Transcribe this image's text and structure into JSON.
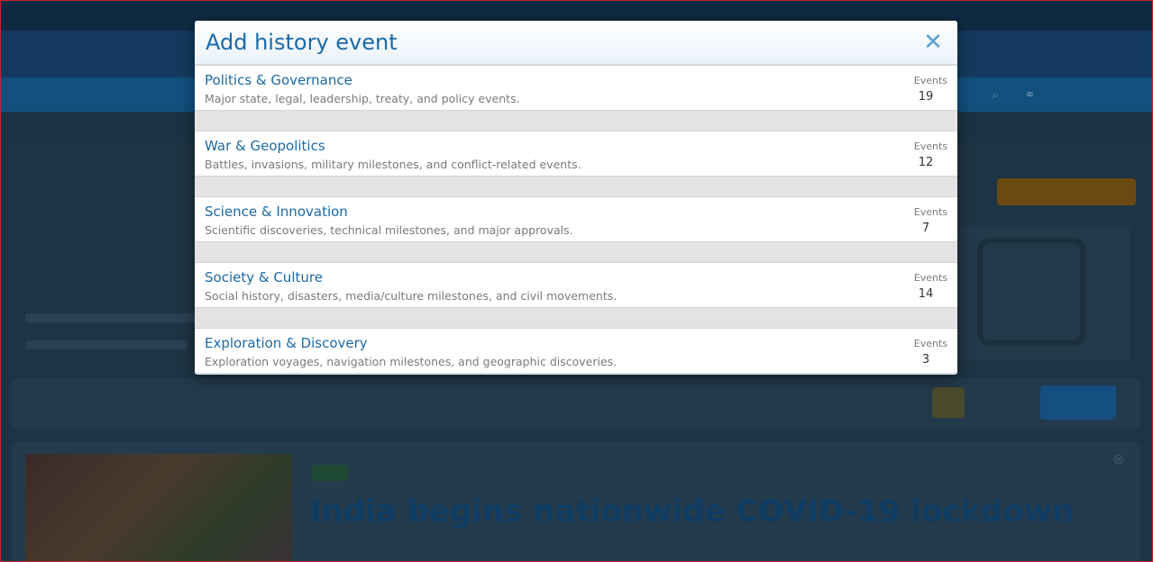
{
  "modal": {
    "title": "Add history event",
    "close_icon": "close-icon",
    "categories": [
      {
        "name": "Politics & Governance",
        "description": "Major state, legal, leadership, treaty, and policy events.",
        "count_label": "Events",
        "count": "19"
      },
      {
        "name": "War & Geopolitics",
        "description": "Battles, invasions, military milestones, and conflict-related events.",
        "count_label": "Events",
        "count": "12"
      },
      {
        "name": "Science & Innovation",
        "description": "Scientific discoveries, technical milestones, and major approvals.",
        "count_label": "Events",
        "count": "7"
      },
      {
        "name": "Society & Culture",
        "description": "Social history, disasters, media/culture milestones, and civil movements.",
        "count_label": "Events",
        "count": "14"
      },
      {
        "name": "Exploration & Discovery",
        "description": "Exploration voyages, navigation milestones, and geographic discoveries.",
        "count_label": "Events",
        "count": "3"
      }
    ]
  },
  "background": {
    "headline": "India begins nationwide COVID-19 lockdown"
  },
  "colors": {
    "accent": "#1a6aa8",
    "close": "#5e9fd2",
    "overlay": "#1b3344"
  }
}
